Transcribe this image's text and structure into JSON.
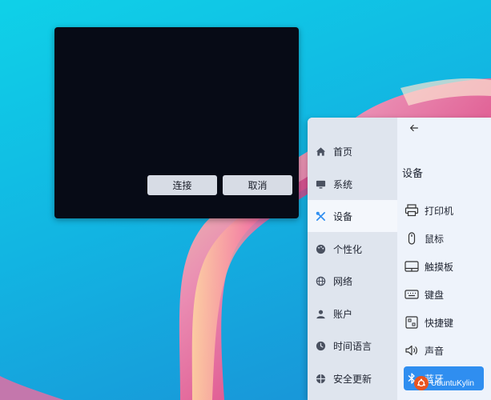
{
  "dialog": {
    "connect_label": "连接",
    "cancel_label": "取消"
  },
  "settings": {
    "back_icon": "arrow-left-icon",
    "section_title": "设备",
    "sidebar": {
      "items": [
        {
          "label": "首页",
          "icon": "home-icon"
        },
        {
          "label": "系统",
          "icon": "monitor-icon"
        },
        {
          "label": "设备",
          "icon": "devices-icon",
          "active": true
        },
        {
          "label": "个性化",
          "icon": "palette-icon"
        },
        {
          "label": "网络",
          "icon": "globe-icon"
        },
        {
          "label": "账户",
          "icon": "user-icon"
        },
        {
          "label": "时间语言",
          "icon": "clock-icon"
        },
        {
          "label": "安全更新",
          "icon": "shield-icon"
        }
      ]
    },
    "devices": [
      {
        "label": "打印机",
        "icon": "printer-icon"
      },
      {
        "label": "鼠标",
        "icon": "mouse-icon"
      },
      {
        "label": "触摸板",
        "icon": "touchpad-icon"
      },
      {
        "label": "键盘",
        "icon": "keyboard-icon"
      },
      {
        "label": "快捷键",
        "icon": "shortcut-icon"
      },
      {
        "label": "声音",
        "icon": "speaker-icon"
      },
      {
        "label": "蓝牙",
        "icon": "bluetooth-icon",
        "active": true
      }
    ]
  },
  "watermark": {
    "text": "UbuntuKylin"
  },
  "colors": {
    "accent": "#2f8ef0",
    "dialog_bg": "#070b16",
    "sidebar_bg": "#dfe5ee",
    "content_bg": "#eef3fb"
  }
}
